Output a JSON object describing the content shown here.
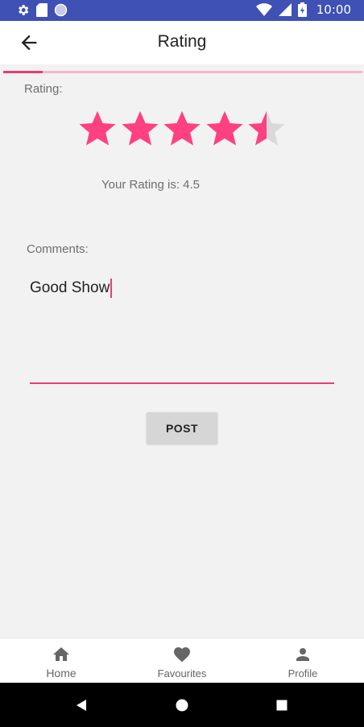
{
  "status_bar": {
    "time": "10:00",
    "left_icons": [
      "gear-icon",
      "sd-card-icon",
      "sync-circle-icon"
    ],
    "right_icons": [
      "wifi-icon",
      "signal-icon",
      "battery-icon"
    ]
  },
  "app_bar": {
    "title": "Rating",
    "back_icon": "arrow-back-icon"
  },
  "progress": {
    "fraction": 0.11,
    "track_color": "#f5b7c9",
    "fill_color": "#e83d73"
  },
  "rating": {
    "label": "Rating:",
    "max_stars": 5,
    "value": 4.5,
    "result_text": "Your Rating is: 4.5",
    "star_color": "#ff4081",
    "empty_color": "#d9d9d9"
  },
  "comments": {
    "label": "Comments:",
    "value": "Good Show"
  },
  "post_button": {
    "label": "POST"
  },
  "bottom_nav": {
    "items": [
      {
        "label": "Home",
        "icon": "home-icon"
      },
      {
        "label": "Favourites",
        "icon": "heart-icon"
      },
      {
        "label": "Profile",
        "icon": "person-icon"
      }
    ]
  },
  "system_nav": {
    "icons": [
      "back-triangle-icon",
      "home-circle-icon",
      "recents-square-icon"
    ]
  },
  "colors": {
    "status_bar": "#3f51b5",
    "accent": "#e83d73"
  }
}
